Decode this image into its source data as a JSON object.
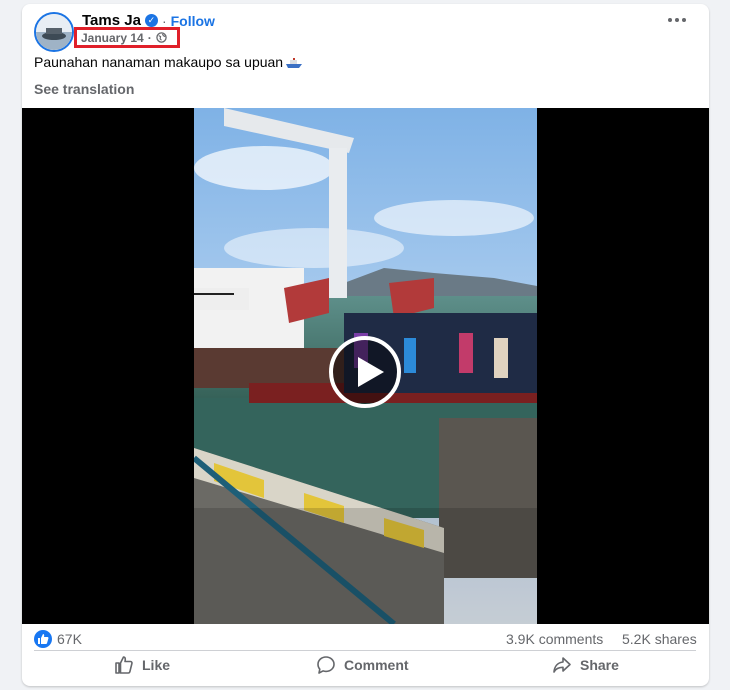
{
  "post": {
    "author": "Tams Ja",
    "follow_label": "Follow",
    "separator": "·",
    "date": "January 14",
    "separator_small": "·",
    "text": "Paunahan nanaman makaupo sa upuan",
    "see_translation": "See translation"
  },
  "stats": {
    "reactions": "67K",
    "comments": "3.9K comments",
    "shares": "5.2K shares"
  },
  "actions": {
    "like": "Like",
    "comment": "Comment",
    "share": "Share"
  },
  "colors": {
    "brand_blue": "#1b74e4",
    "highlight_box": "#e0202a",
    "secondary_text": "#65676b"
  },
  "icons": {
    "verified": "verified-badge-icon",
    "privacy": "globe-icon",
    "more": "more-options-icon",
    "play": "play-icon",
    "reaction": "thumbs-up-icon",
    "like": "like-icon",
    "comment": "comment-icon",
    "share": "share-icon",
    "emoji": "ship-emoji-icon"
  }
}
